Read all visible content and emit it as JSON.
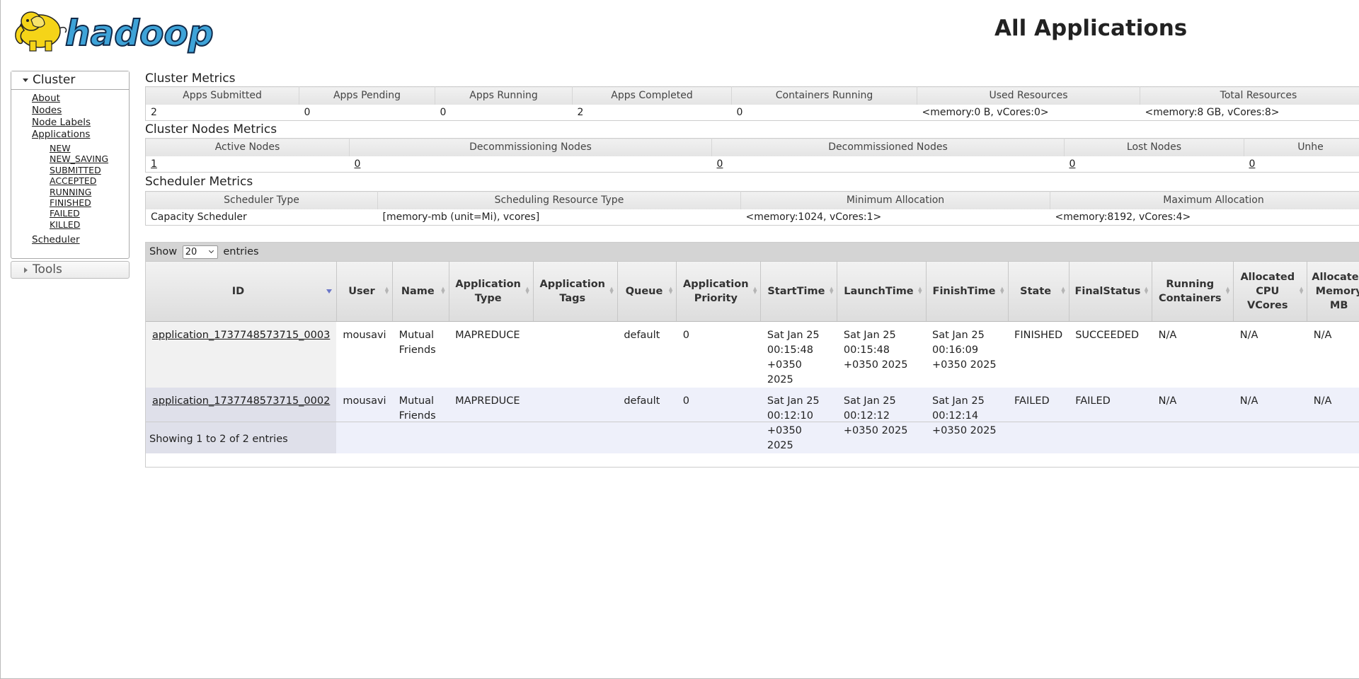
{
  "header": {
    "logo_text": "hadoop",
    "title": "All Applications"
  },
  "sidebar": {
    "cluster_label": "Cluster",
    "links": [
      "About",
      "Nodes",
      "Node Labels",
      "Applications"
    ],
    "app_states": [
      "NEW",
      "NEW_SAVING",
      "SUBMITTED",
      "ACCEPTED",
      "RUNNING",
      "FINISHED",
      "FAILED",
      "KILLED"
    ],
    "scheduler_label": "Scheduler",
    "tools_label": "Tools"
  },
  "cluster_metrics": {
    "title": "Cluster Metrics",
    "headers": [
      "Apps Submitted",
      "Apps Pending",
      "Apps Running",
      "Apps Completed",
      "Containers Running",
      "Used Resources",
      "Total Resources"
    ],
    "values": [
      "2",
      "0",
      "0",
      "2",
      "0",
      "<memory:0 B, vCores:0>",
      "<memory:8 GB, vCores:8>"
    ]
  },
  "nodes_metrics": {
    "title": "Cluster Nodes Metrics",
    "headers": [
      "Active Nodes",
      "Decommissioning Nodes",
      "Decommissioned Nodes",
      "Lost Nodes",
      "Unhe"
    ],
    "values": [
      "1",
      "0",
      "0",
      "0",
      "0"
    ]
  },
  "scheduler_metrics": {
    "title": "Scheduler Metrics",
    "headers": [
      "Scheduler Type",
      "Scheduling Resource Type",
      "Minimum Allocation",
      "Maximum Allocation"
    ],
    "values": [
      "Capacity Scheduler",
      "[memory-mb (unit=Mi), vcores]",
      "<memory:1024, vCores:1>",
      "<memory:8192, vCores:4>"
    ]
  },
  "apps_table": {
    "show_label": "Show",
    "page_size": "20",
    "entries_label": "entries",
    "columns": [
      {
        "label": "ID"
      },
      {
        "label": "User"
      },
      {
        "label": "Name"
      },
      {
        "label": "Application Type"
      },
      {
        "label": "Application Tags"
      },
      {
        "label": "Queue"
      },
      {
        "label": "Application Priority"
      },
      {
        "label": "StartTime"
      },
      {
        "label": "LaunchTime"
      },
      {
        "label": "FinishTime"
      },
      {
        "label": "State"
      },
      {
        "label": "FinalStatus"
      },
      {
        "label": "Running Containers"
      },
      {
        "label": "Allocated CPU VCores"
      },
      {
        "label": "Allocated Memory MB"
      }
    ],
    "rows": [
      {
        "id": "application_1737748573715_0003",
        "user": "mousavi",
        "name": "Mutual Friends",
        "type": "MAPREDUCE",
        "tags": "",
        "queue": "default",
        "priority": "0",
        "start": "Sat Jan 25 00:15:48 +0350 2025",
        "launch": "Sat Jan 25 00:15:48 +0350 2025",
        "finish": "Sat Jan 25 00:16:09 +0350 2025",
        "state": "FINISHED",
        "final_status": "SUCCEEDED",
        "running_containers": "N/A",
        "cpu_vcores": "N/A",
        "memory_mb": "N/A"
      },
      {
        "id": "application_1737748573715_0002",
        "user": "mousavi",
        "name": "Mutual Friends",
        "type": "MAPREDUCE",
        "tags": "",
        "queue": "default",
        "priority": "0",
        "start": "Sat Jan 25 00:12:10 +0350 2025",
        "launch": "Sat Jan 25 00:12:12 +0350 2025",
        "finish": "Sat Jan 25 00:12:14 +0350 2025",
        "state": "FAILED",
        "final_status": "FAILED",
        "running_containers": "N/A",
        "cpu_vcores": "N/A",
        "memory_mb": "N/A"
      }
    ],
    "info": "Showing 1 to 2 of 2 entries"
  },
  "colors": {
    "logo_yellow": "#f5d418",
    "logo_blue": "#3ea3d8",
    "row_even": "#eef0fa",
    "sort_arrow": "#6b77c8"
  }
}
